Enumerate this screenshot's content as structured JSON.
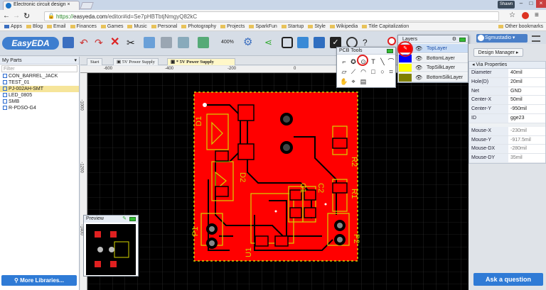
{
  "browser": {
    "tab_title": "Electronic circuit design",
    "profile": "Shawn",
    "url_scheme": "https://",
    "url_host": "easyeda.com",
    "url_path": "/editor#id=Se7pHBTbtjNmgyQ82kC"
  },
  "bookmarks": {
    "items": [
      "Apps",
      "Blog",
      "Email",
      "Finances",
      "Games",
      "Music",
      "Personal",
      "Photography",
      "Projects",
      "SparkFun",
      "Startup",
      "Style",
      "Wikipedia",
      "Title Capitalization"
    ],
    "other": "Other bookmarks"
  },
  "toolbar": {
    "logo": "EasyEDA",
    "zoom": "400%",
    "user": "Sgmustadio"
  },
  "left_panel": {
    "title": "My Parts",
    "filter_placeholder": "Filter",
    "parts": [
      "CON_BARREL_JACK",
      "TEST_01",
      "PJ-002AH-SMT",
      "LED_0805",
      "SMB",
      "R-PDSO-G4"
    ],
    "selected_index": 2,
    "more_libraries": "More Libraries..."
  },
  "doc_tabs": [
    "Start",
    "5V Power Supply",
    "* 5V Power Supply"
  ],
  "rulers": {
    "h": [
      "-600",
      "-400",
      "-200",
      "0"
    ],
    "v": [
      "-1000",
      "-1200",
      "-1400"
    ]
  },
  "pcb_tools": {
    "title": "PCB Tools",
    "tools": [
      "track-tool",
      "pad-tool",
      "via-tool",
      "text-tool",
      "line-tool",
      "arc-tool",
      "hole-tool",
      "copper-area-tool",
      "circle-tool",
      "rect-tool",
      "solid-region-tool",
      "dimension-tool",
      "pan-tool",
      "measure-tool",
      "image-tool"
    ]
  },
  "layers": {
    "title": "Layers",
    "items": [
      {
        "name": "TopLayer",
        "color": "#ff0000",
        "active": true
      },
      {
        "name": "BottomLayer",
        "color": "#0000ff",
        "active": false
      },
      {
        "name": "TopSilkLayer",
        "color": "#ffff00",
        "active": false
      },
      {
        "name": "BottomSilkLayer",
        "color": "#808000",
        "active": false
      }
    ]
  },
  "right_panel": {
    "design_manager": "Design Manager",
    "section": "Via Properties",
    "properties": [
      {
        "key": "Diameter",
        "value": "40mil"
      },
      {
        "key": "Hole(D)",
        "value": "20mil"
      },
      {
        "key": "Net",
        "value": "GND"
      },
      {
        "key": "Center-X",
        "value": "50mil"
      },
      {
        "key": "Center-Y",
        "value": "-950mil"
      },
      {
        "key": "ID",
        "value": "gge23"
      }
    ],
    "mouse": [
      {
        "key": "Mouse-X",
        "value": "-230mil"
      },
      {
        "key": "Mouse-Y",
        "value": "-917.5mil"
      },
      {
        "key": "Mouse-DX",
        "value": "-280mil"
      },
      {
        "key": "Mouse-DY",
        "value": "35mil"
      }
    ],
    "ask": "Ask a question"
  },
  "preview": {
    "title": "Preview"
  },
  "pcb_labels": [
    "D1",
    "D2",
    "U1",
    "R2",
    "R1",
    "C1",
    "C2",
    "P1",
    "P2"
  ],
  "colors": {
    "copper": "#ff0000",
    "silk": "#d4d400",
    "canvas": "#000000",
    "accent": "#2f7bd6"
  }
}
